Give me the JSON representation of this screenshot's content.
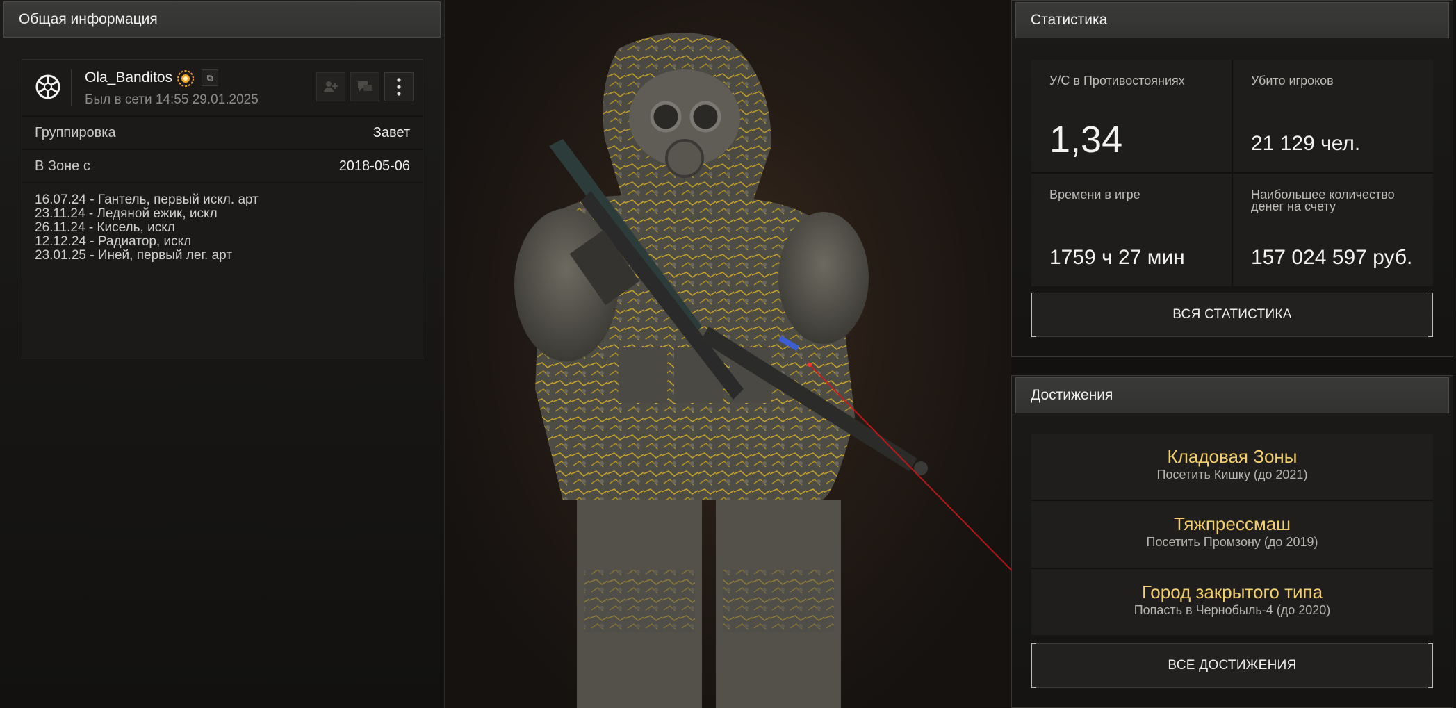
{
  "left_panel": {
    "header": "Общая информация",
    "profile": {
      "nickname": "Ola_Banditos",
      "last_seen": "Был в сети 14:55 29.01.2025"
    },
    "rows": [
      {
        "label": "Группировка",
        "value": "Завет"
      },
      {
        "label": "В Зоне с",
        "value": "2018-05-06"
      }
    ],
    "notes": [
      "16.07.24 - Гантель, первый искл. арт",
      "23.11.24 - Ледяной ежик, искл",
      "26.11.24 - Кисель, искл",
      "12.12.24 - Радиатор, искл",
      "23.01.25 - Иней, первый лег. арт"
    ]
  },
  "stats_panel": {
    "header": "Статистика",
    "cells": [
      {
        "label": "У/С в Противостояниях",
        "value": "1,34"
      },
      {
        "label": "Убито игроков",
        "value": "21 129 чел."
      },
      {
        "label": "Времени в игре",
        "value": "1759 ч 27 мин"
      },
      {
        "label": "Наибольшее количество денег на счету",
        "value": "157 024 597 руб."
      }
    ],
    "button": "ВСЯ СТАТИСТИКА"
  },
  "achievements_panel": {
    "header": "Достижения",
    "items": [
      {
        "title": "Кладовая Зоны",
        "desc": "Посетить Кишку (до 2021)"
      },
      {
        "title": "Тяжпрессмаш",
        "desc": "Посетить Промзону (до 2019)"
      },
      {
        "title": "Город закрытого типа",
        "desc": "Попасть в Чернобыль-4 (до 2020)"
      }
    ],
    "button": "ВСЕ ДОСТИЖЕНИЯ"
  },
  "colors": {
    "achievement_title": "#f2cf6c",
    "panel_header": "#363635",
    "badge": "#f4a524",
    "laser": "#d01818"
  },
  "icons": [
    "clan-emblem-icon",
    "rank-badge-icon",
    "copy-icon",
    "add-friend-icon",
    "message-icon",
    "more-menu-icon"
  ]
}
